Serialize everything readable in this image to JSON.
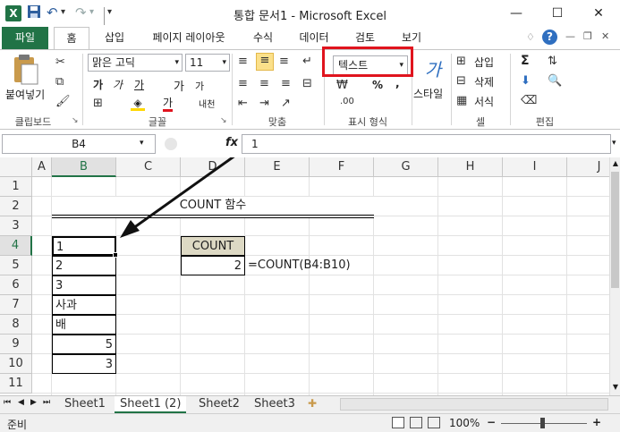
{
  "window": {
    "title": "통합 문서1 - Microsoft Excel",
    "minimize": "—",
    "restore": "☐",
    "close": "✕"
  },
  "quick_access": {
    "save_icon": "save-icon",
    "undo": "↶",
    "redo": "↷",
    "customize": "▾"
  },
  "ribbon_tabs": [
    "파일",
    "홈",
    "삽입",
    "페이지 레이아웃",
    "수식",
    "데이터",
    "검토",
    "보기"
  ],
  "ribbon": {
    "clipboard": {
      "paste": "붙여넣기",
      "label": "클립보드"
    },
    "font": {
      "name": "맑은 고딕",
      "size": "11",
      "bold": "가",
      "italic": "가",
      "underline": "가",
      "grow": "가",
      "shrink": "가",
      "phonetic": "내천",
      "label": "글꼴"
    },
    "alignment": {
      "label": "맞춤"
    },
    "number": {
      "format": "텍스트",
      "percent": "%",
      "comma": ",",
      "label": "표시 형식"
    },
    "styles": {
      "label": "스타일"
    },
    "cells": {
      "insert": "삽입",
      "delete": "삭제",
      "format": "서식",
      "label": "셀"
    },
    "editing": {
      "sigma": "Σ",
      "label": "편집"
    }
  },
  "formula_bar": {
    "name_box": "B4",
    "fx": "fx",
    "value": "1"
  },
  "columns": [
    "A",
    "B",
    "C",
    "D",
    "E",
    "F",
    "G",
    "H",
    "I",
    "J"
  ],
  "rows": [
    "1",
    "2",
    "3",
    "4",
    "5",
    "6",
    "7",
    "8",
    "9",
    "10",
    "11"
  ],
  "cells": {
    "title": "COUNT 함수",
    "b4": "1",
    "b5": "2",
    "b6": "3",
    "b7": "사과",
    "b8": "배",
    "b9": "5",
    "b10": "3",
    "d4": "COUNT",
    "d5": "2",
    "e5": "=COUNT(B4:B10)"
  },
  "sheets": [
    "Sheet1",
    "Sheet1 (2)",
    "Sheet2",
    "Sheet3"
  ],
  "status": {
    "ready": "준비",
    "zoom": "100%",
    "minus": "−",
    "plus": "+"
  },
  "colors": {
    "accent": "#217346",
    "annotation": "#e0141e"
  }
}
